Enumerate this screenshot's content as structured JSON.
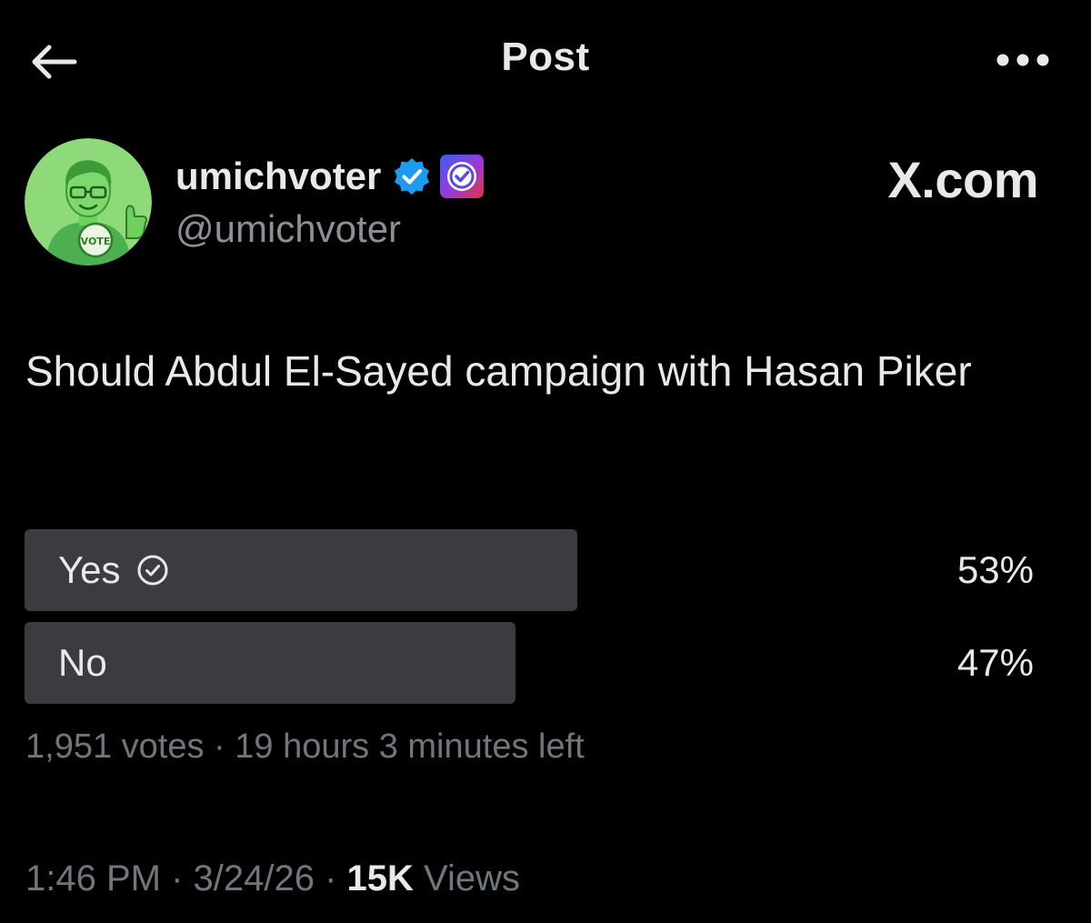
{
  "header": {
    "title": "Post",
    "back_icon": "arrow-left-icon",
    "more_icon": "more-horizontal-icon"
  },
  "author": {
    "display_name": "umichvoter",
    "handle": "@umichvoter",
    "avatar_badge_text": "VOTE",
    "verified_color": "#1d9bf0"
  },
  "watermark": "X.com",
  "post": {
    "text": "Should Abdul El-Sayed campaign with Hasan Piker"
  },
  "poll": {
    "options": [
      {
        "label": "Yes",
        "percent_text": "53%",
        "share": 0.53,
        "selected": true
      },
      {
        "label": "No",
        "percent_text": "47%",
        "share": 0.47,
        "selected": false
      }
    ],
    "votes": "1,951 votes",
    "separator": " · ",
    "time_left": "19 hours 3 minutes left"
  },
  "meta": {
    "time": "1:46 PM",
    "date": "3/24/26",
    "views_count": "15K",
    "views_label": " Views",
    "separator": " · "
  },
  "colors": {
    "background": "#000000",
    "text": "#e7e9ea",
    "secondary": "#71767b",
    "poll_bar": "#3b3c40",
    "avatar_green": "#8ed97a"
  }
}
